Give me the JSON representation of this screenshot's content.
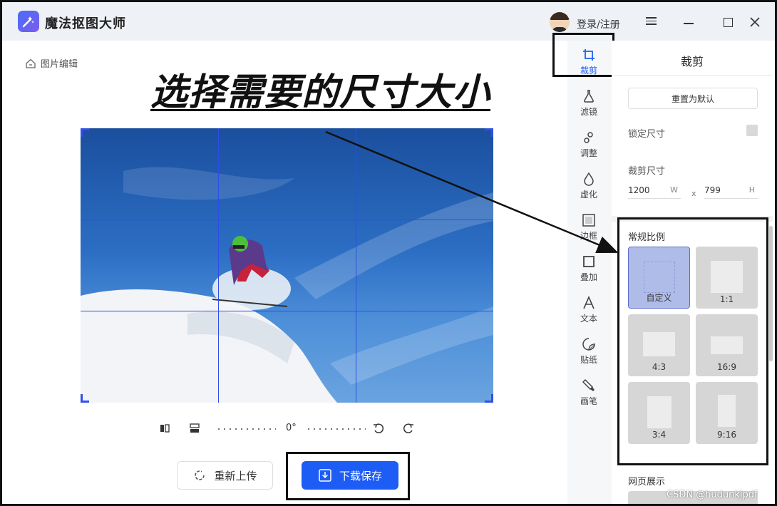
{
  "app": {
    "title": "魔法抠图大师",
    "login_label": "登录/注册"
  },
  "workspace": {
    "back_label": "图片编辑",
    "headline": "选择需要的尺寸大小",
    "rotation_angle": "0°",
    "reupload_label": "重新上传",
    "download_label": "下载保存"
  },
  "tools": [
    {
      "label": "裁剪",
      "icon": "crop-icon",
      "active": true
    },
    {
      "label": "滤镜",
      "icon": "filter-flask-icon",
      "active": false
    },
    {
      "label": "调整",
      "icon": "adjust-sliders-icon",
      "active": false
    },
    {
      "label": "虚化",
      "icon": "blur-drop-icon",
      "active": false
    },
    {
      "label": "边框",
      "icon": "border-frame-icon",
      "active": false
    },
    {
      "label": "叠加",
      "icon": "overlay-square-icon",
      "active": false
    },
    {
      "label": "文本",
      "icon": "text-a-icon",
      "active": false
    },
    {
      "label": "贴纸",
      "icon": "sticker-icon",
      "active": false
    },
    {
      "label": "画笔",
      "icon": "brush-icon",
      "active": false
    }
  ],
  "panel": {
    "title": "裁剪",
    "reset_label": "重置为默认",
    "lock_label": "锁定尺寸",
    "crop_size_label": "裁剪尺寸",
    "width_value": "1200",
    "width_unit": "W",
    "times": "x",
    "height_value": "799",
    "height_unit": "H",
    "ratio_section_label": "常规比例",
    "ratios": [
      {
        "label": "自定义",
        "selected": true
      },
      {
        "label": "1:1",
        "selected": false
      },
      {
        "label": "4:3",
        "selected": false
      },
      {
        "label": "16:9",
        "selected": false
      },
      {
        "label": "3:4",
        "selected": false
      },
      {
        "label": "9:16",
        "selected": false
      }
    ],
    "web_section_label": "网页展示"
  },
  "watermark": "CSDN @hudunkjpdf",
  "colors": {
    "accent": "#1d5cf5",
    "grid": "#2e4de8",
    "titlebar": "#eef1f6"
  }
}
